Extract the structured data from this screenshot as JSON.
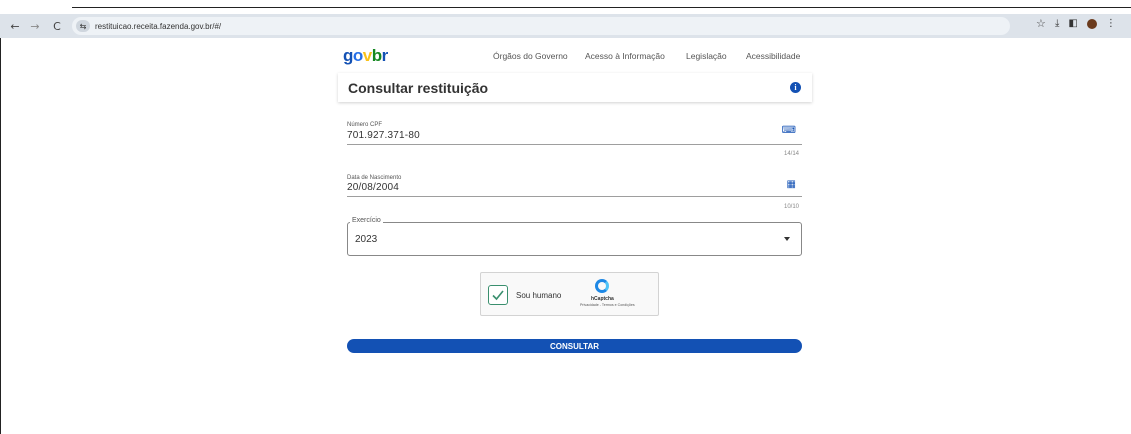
{
  "browser": {
    "url": "restituicao.receita.fazenda.gov.br/#/",
    "back_icon": "←",
    "forward_icon": "→",
    "reload_icon": "C"
  },
  "header": {
    "logo": {
      "g": "g",
      "o": "o",
      "v": "v",
      "b": "b",
      "r": "r"
    },
    "nav": [
      "Órgãos do Governo",
      "Acesso à Informação",
      "Legislação",
      "Acessibilidade"
    ]
  },
  "page": {
    "title": "Consultar restituição",
    "info_glyph": "i"
  },
  "form": {
    "cpf": {
      "label": "Número CPF",
      "value": "701.927.371-80",
      "counter": "14/14"
    },
    "birth": {
      "label": "Data de Nascimento",
      "value": "20/08/2004",
      "counter": "10/10"
    },
    "exercicio": {
      "label": "Exercício",
      "value": "2023"
    }
  },
  "captcha": {
    "label": "Sou humano",
    "brand": "hCaptcha",
    "links": "Privacidade - Termos e Condições",
    "checked": true
  },
  "submit_label": "CONSULTAR",
  "colors": {
    "primary": "#1351b4",
    "chrome": "#dde3ea",
    "check": "#3a8f6e"
  }
}
